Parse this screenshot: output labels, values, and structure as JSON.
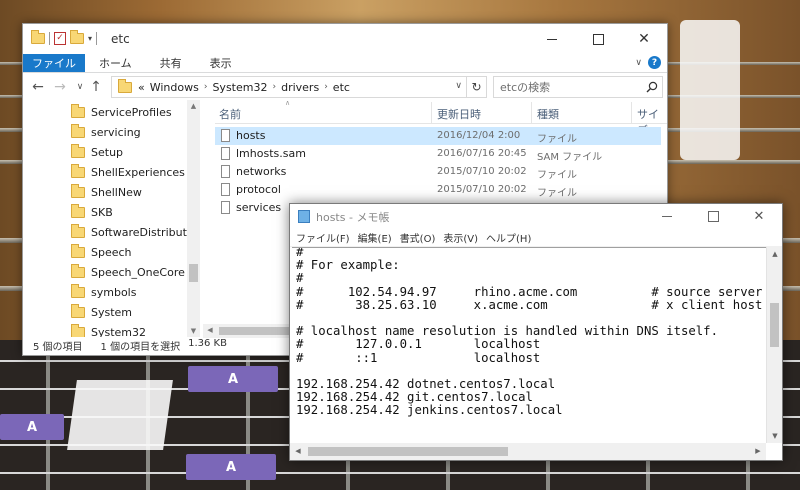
{
  "desktop": {
    "fret_markers": [
      "A",
      "A",
      "A"
    ]
  },
  "explorer": {
    "title": "etc",
    "ribbon_tabs": [
      "ファイル",
      "ホーム",
      "共有",
      "表示"
    ],
    "help_glyph": "?",
    "address": {
      "overflow": "«",
      "crumbs": [
        "Windows",
        "System32",
        "drivers",
        "etc"
      ]
    },
    "search_placeholder": "etcの検索",
    "nav_items": [
      "ServiceProfiles",
      "servicing",
      "Setup",
      "ShellExperiences",
      "ShellNew",
      "SKB",
      "SoftwareDistribution",
      "Speech",
      "Speech_OneCore",
      "symbols",
      "System",
      "System32"
    ],
    "columns": [
      "名前",
      "更新日時",
      "種類",
      "サイズ"
    ],
    "files": [
      {
        "name": "hosts",
        "date": "2016/12/04 2:00",
        "type": "ファイル",
        "selected": true
      },
      {
        "name": "lmhosts.sam",
        "date": "2016/07/16 20:45",
        "type": "SAM ファイル",
        "selected": false
      },
      {
        "name": "networks",
        "date": "2015/07/10 20:02",
        "type": "ファイル",
        "selected": false
      },
      {
        "name": "protocol",
        "date": "2015/07/10 20:02",
        "type": "ファイル",
        "selected": false
      },
      {
        "name": "services",
        "date": "",
        "type": "",
        "selected": false
      }
    ],
    "status": {
      "items": "5 個の項目",
      "selected": "1 個の項目を選択",
      "size": "1.36 KB"
    }
  },
  "notepad": {
    "title": "hosts - メモ帳",
    "menu": [
      "ファイル(F)",
      "編集(E)",
      "書式(O)",
      "表示(V)",
      "ヘルプ(H)"
    ],
    "content": "#\n# For example:\n#\n#      102.54.94.97     rhino.acme.com          # source server\n#       38.25.63.10     x.acme.com              # x client host\n\n# localhost name resolution is handled within DNS itself.\n#\t127.0.0.1       localhost\n#\t::1             localhost\n\n192.168.254.42 dotnet.centos7.local\n192.168.254.42 git.centos7.local\n192.168.254.42 jenkins.centos7.local"
  }
}
